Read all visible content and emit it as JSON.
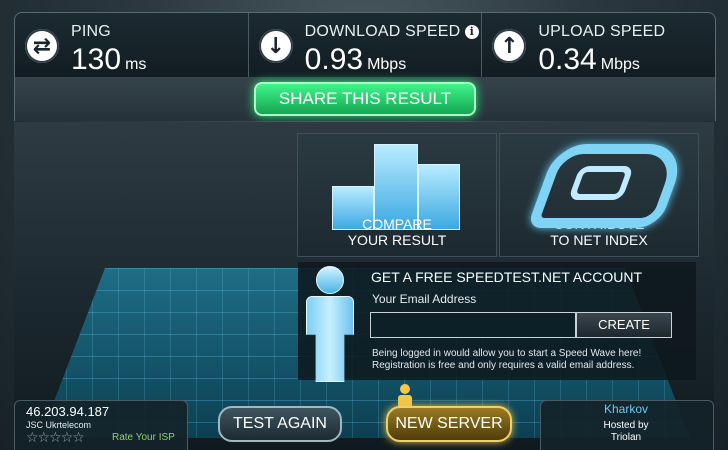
{
  "colors": {
    "share_green": "#2bd06f",
    "new_server_gold": "#e6bf47",
    "isp_rate_green": "#8fd06a",
    "city_blue": "#6fc7ef"
  },
  "stats": {
    "ping": {
      "icon": "swap-arrows-icon",
      "label": "PING",
      "value": "130",
      "unit": "ms"
    },
    "download": {
      "icon": "download-arrow-icon",
      "label": "DOWNLOAD SPEED",
      "value": "0.93",
      "unit": "Mbps",
      "info_icon": "i"
    },
    "upload": {
      "icon": "upload-arrow-icon",
      "label": "UPLOAD SPEED",
      "value": "0.34",
      "unit": "Mbps"
    }
  },
  "share_label": "SHARE THIS RESULT",
  "tiles": {
    "compare": {
      "line1": "COMPARE",
      "line2": "YOUR RESULT"
    },
    "contribute": {
      "line1": "CONTRIBUTE",
      "line2": "TO NET INDEX"
    }
  },
  "account": {
    "heading": "GET A FREE SPEEDTEST.NET ACCOUNT",
    "email_label": "Your Email Address",
    "email_value": "",
    "create_label": "CREATE",
    "note_line1": "Being logged in would allow you to start a Speed Wave here!",
    "note_line2": "Registration is free and only requires a valid email address."
  },
  "isp": {
    "ip": "46.203.94.187",
    "name": "JSC Ukrtelecom",
    "stars": "☆☆☆☆☆",
    "rate_label": "Rate Your ISP"
  },
  "buttons": {
    "test_again": "TEST AGAIN",
    "new_server": "NEW SERVER"
  },
  "server": {
    "city": "Kharkov",
    "hosted_by": "Hosted by",
    "host": "Triolan"
  }
}
